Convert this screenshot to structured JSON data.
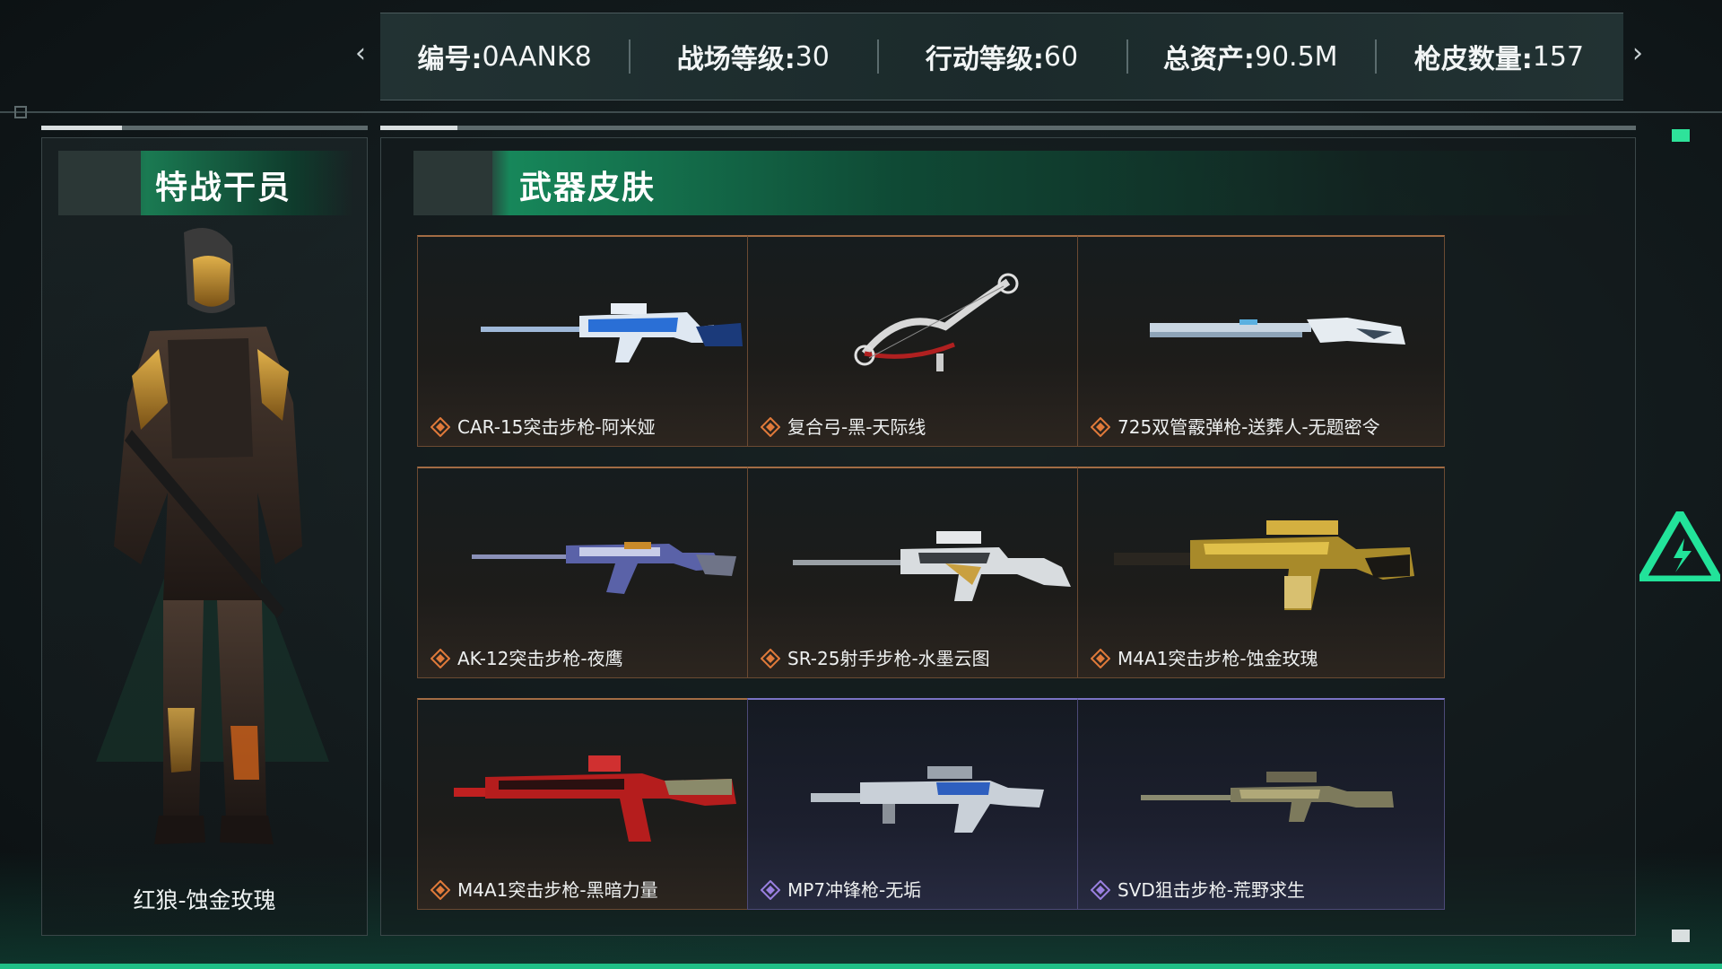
{
  "stats": [
    {
      "label": "编号:",
      "value": "0AANK8"
    },
    {
      "label": "战场等级:",
      "value": "30"
    },
    {
      "label": "行动等级:",
      "value": "60"
    },
    {
      "label": "总资产:",
      "value": "90.5M"
    },
    {
      "label": "枪皮数量:",
      "value": "157"
    }
  ],
  "agent": {
    "title": "特战干员",
    "name": "红狼-蚀金玫瑰"
  },
  "skins": {
    "title": "武器皮肤",
    "items": [
      {
        "name": "CAR-15突击步枪-阿米娅",
        "rarity": "orange"
      },
      {
        "name": "复合弓-黑-天际线",
        "rarity": "orange"
      },
      {
        "name": "725双管霰弹枪-送葬人-无题密令",
        "rarity": "orange"
      },
      {
        "name": "AK-12突击步枪-夜鹰",
        "rarity": "orange"
      },
      {
        "name": "SR-25射手步枪-水墨云图",
        "rarity": "orange"
      },
      {
        "name": "M4A1突击步枪-蚀金玫瑰",
        "rarity": "orange"
      },
      {
        "name": "M4A1突击步枪-黑暗力量",
        "rarity": "orange"
      },
      {
        "name": "MP7冲锋枪-无垢",
        "rarity": "purple"
      },
      {
        "name": "SVD狙击步枪-荒野求生",
        "rarity": "purple"
      }
    ]
  },
  "colors": {
    "accent_green": "#1fbf86",
    "rarity_orange": "#e07a3a",
    "rarity_purple": "#9a7fe0"
  }
}
